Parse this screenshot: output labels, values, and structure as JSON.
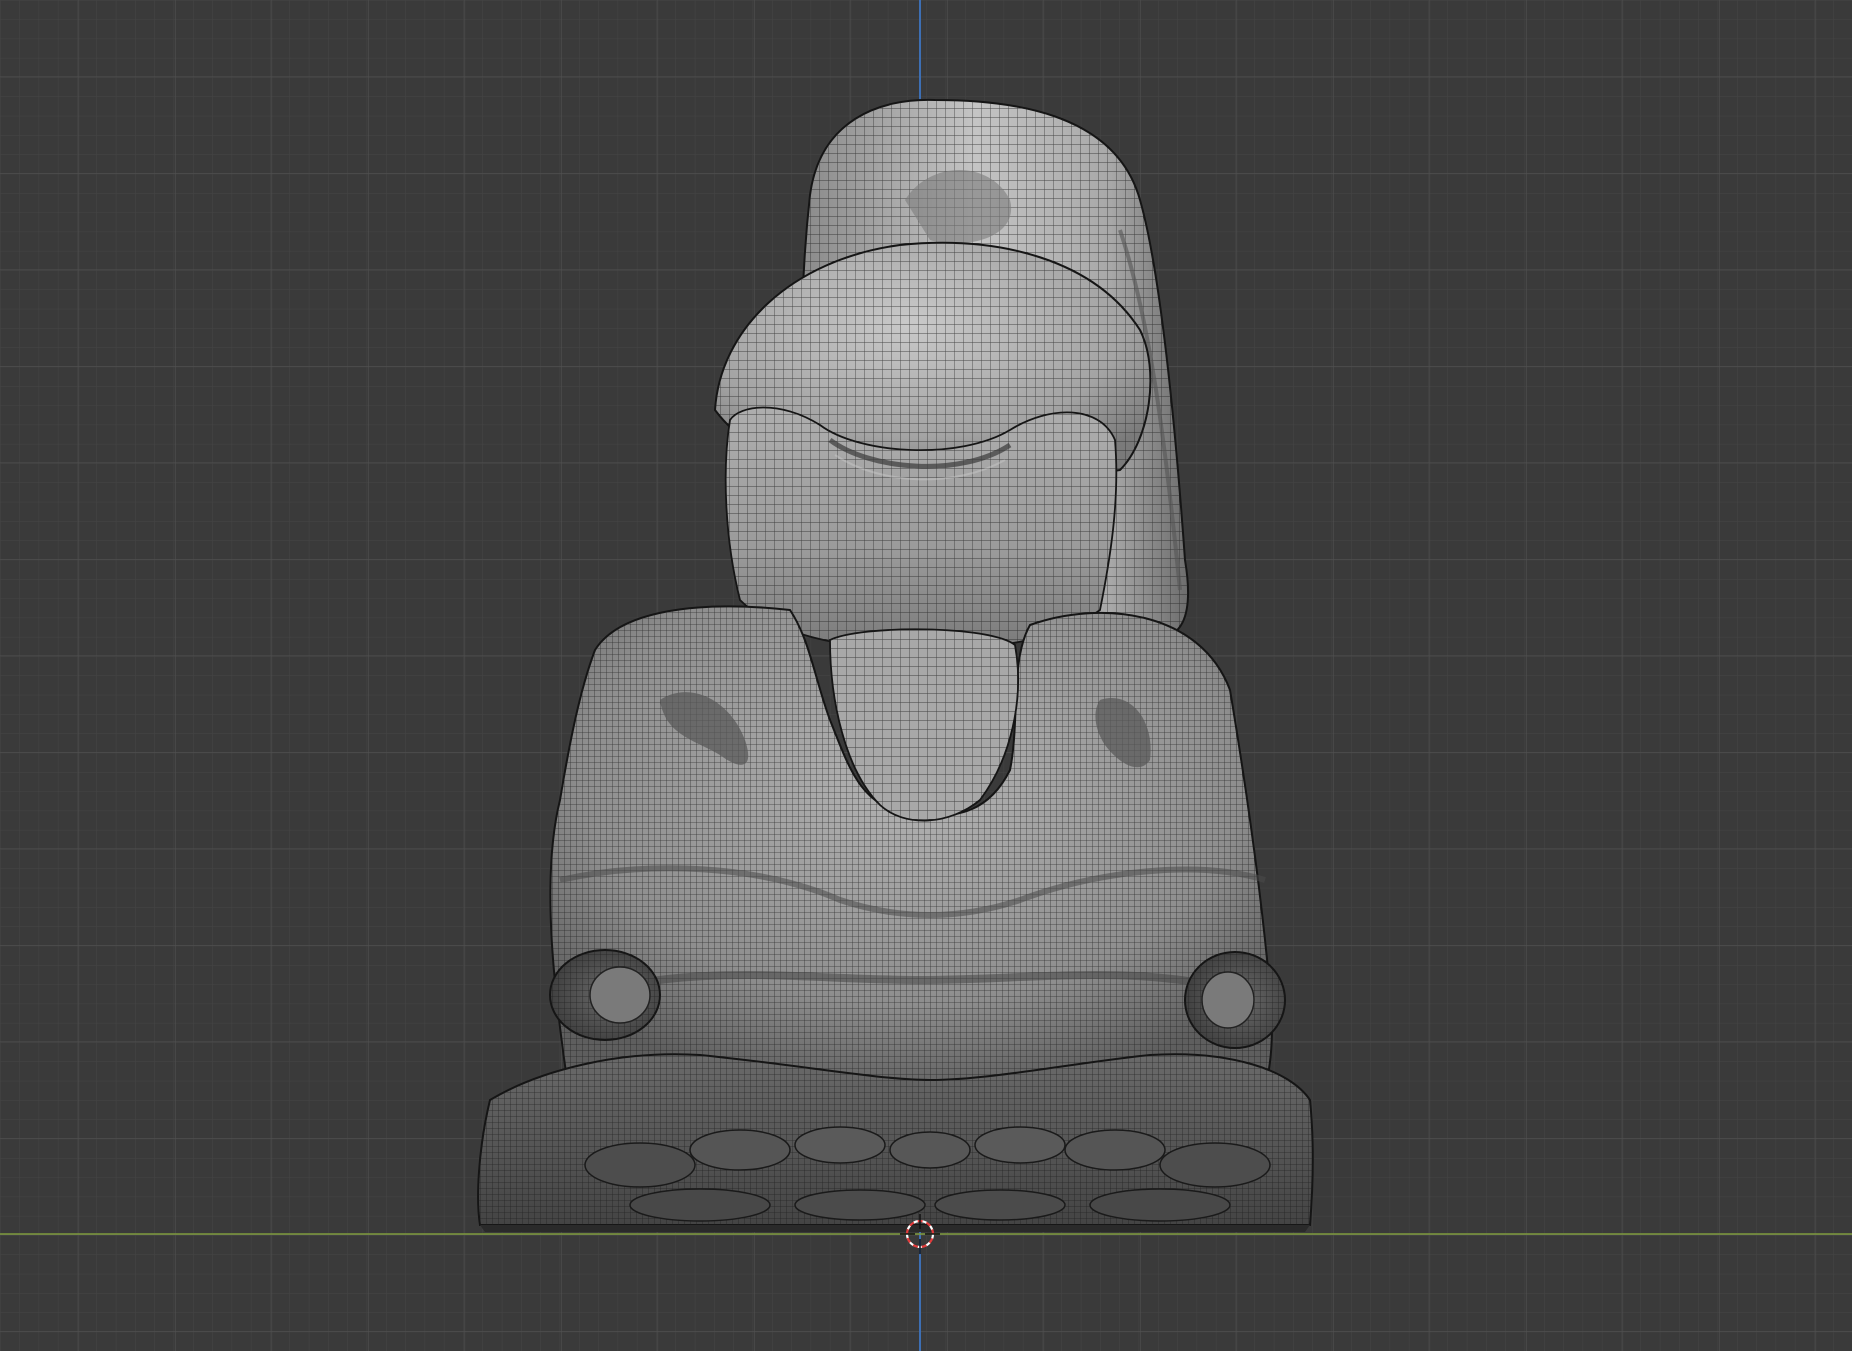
{
  "viewport": {
    "view": "front-orthographic",
    "shading": "solid-wireframe-overlay",
    "object": "sneaker-mesh",
    "colors": {
      "background": "#3a3a3a",
      "grid_minor": "#454545",
      "grid_major": "#4f4f4f",
      "axis_x": "#7e9a3c",
      "axis_z": "#3d6fb4",
      "mesh_light": "#b9b9b9",
      "mesh_dark": "#2b2b2b",
      "wire": "#1c1c1c",
      "cursor_red": "#e23b3b",
      "cursor_white": "#ffffff"
    }
  }
}
